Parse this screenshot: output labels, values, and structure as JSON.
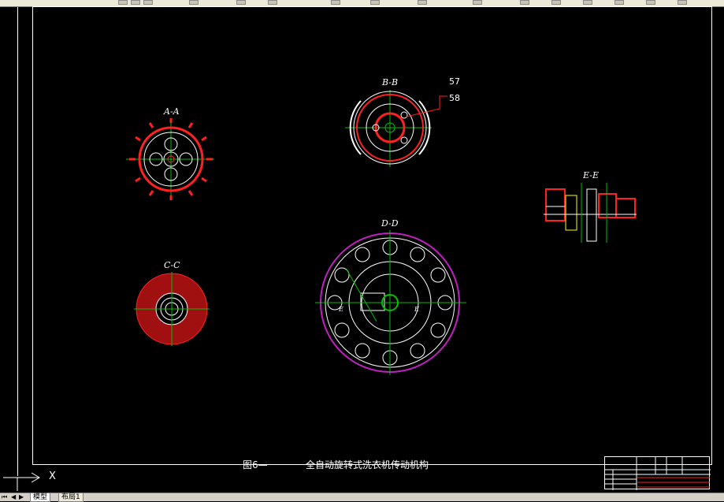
{
  "window": {
    "toolbar_icon": "toolbar-icons"
  },
  "views": {
    "aa": "A-A",
    "bb": "B-B",
    "cc": "C-C",
    "dd": "D-D",
    "ee": "E-E"
  },
  "callouts": {
    "c57": "57",
    "c58": "58"
  },
  "dd_marks": {
    "left": "E",
    "right": "E"
  },
  "caption": {
    "figure": "图6—",
    "title": "全自动旋转式洗衣机传动机构"
  },
  "ucs": {
    "x_label": "X"
  },
  "tabs": {
    "model": "模型",
    "layout": "布局1"
  },
  "colors": {
    "background": "#000000",
    "red": "#ff2020",
    "magenta": "#c020c0",
    "green": "#00c000",
    "white": "#ffffff",
    "yellow": "#ffff00"
  }
}
